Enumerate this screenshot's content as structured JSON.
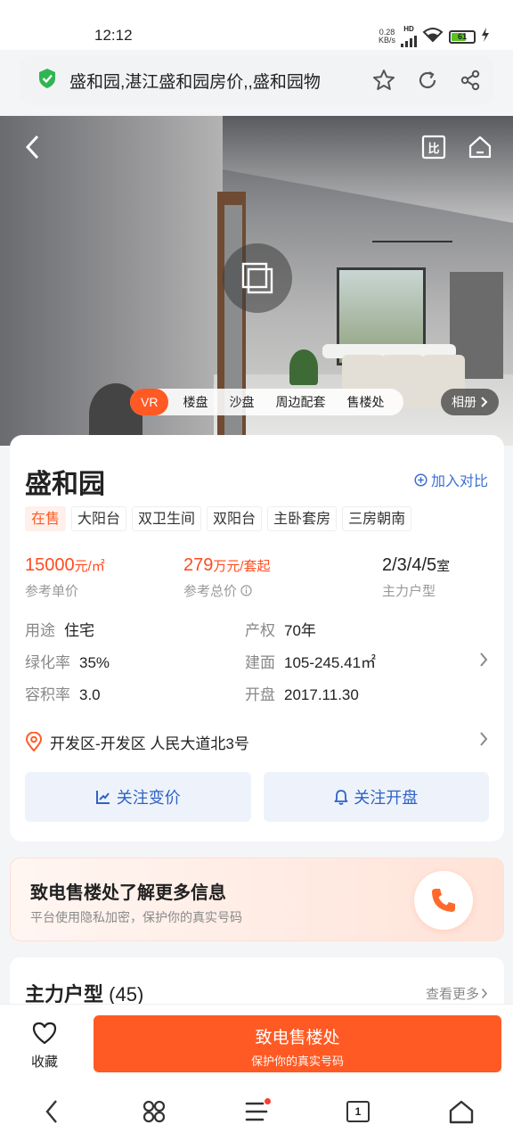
{
  "status": {
    "time": "12:12",
    "net_speed_value": "0.28",
    "net_speed_unit": "KB/s",
    "network": "HD",
    "battery": "61"
  },
  "browser": {
    "page_title": "盛和园,湛江盛和园房价,,盛和园物"
  },
  "hero": {
    "tabs": [
      "VR",
      "楼盘",
      "沙盘",
      "周边配套",
      "售楼处"
    ],
    "album_label": "相册",
    "compare_icon_label": "比"
  },
  "project": {
    "name": "盛和园",
    "add_compare": "加入对比",
    "tags": [
      "在售",
      "大阳台",
      "双卫生间",
      "双阳台",
      "主卧套房",
      "三房朝南"
    ],
    "unit_price": {
      "value": "15000",
      "unit": "元/㎡",
      "label": "参考单价"
    },
    "total_price": {
      "value": "279",
      "unit": "万元/套起",
      "label": "参考总价"
    },
    "main_types": {
      "value": "2/3/4/5",
      "unit": "室",
      "label": "主力户型"
    },
    "details": [
      {
        "key": "用途",
        "value": "住宅"
      },
      {
        "key": "产权",
        "value": "70年"
      },
      {
        "key": "绿化率",
        "value": "35%"
      },
      {
        "key": "建面",
        "value": "105-245.41㎡"
      },
      {
        "key": "容积率",
        "value": "3.0"
      },
      {
        "key": "开盘",
        "value": "2017.11.30"
      }
    ],
    "address": "开发区-开发区 人民大道北3号",
    "follow_price": "关注变价",
    "follow_open": "关注开盘"
  },
  "call_card": {
    "title": "致电售楼处了解更多信息",
    "subtitle": "平台使用隐私加密，保护你的真实号码"
  },
  "floor_plans": {
    "title": "主力户型",
    "count": "(45)",
    "see_more": "查看更多"
  },
  "action_bar": {
    "favorite_label": "收藏",
    "cta_main": "致电售楼处",
    "cta_sub": "保护你的真实号码"
  },
  "nav": {
    "tab_count": "1"
  },
  "colors": {
    "accent": "#ff5a24",
    "price": "#ff4b1f",
    "link_blue": "#3b6fd3",
    "follow_bg": "#eef3fb"
  }
}
